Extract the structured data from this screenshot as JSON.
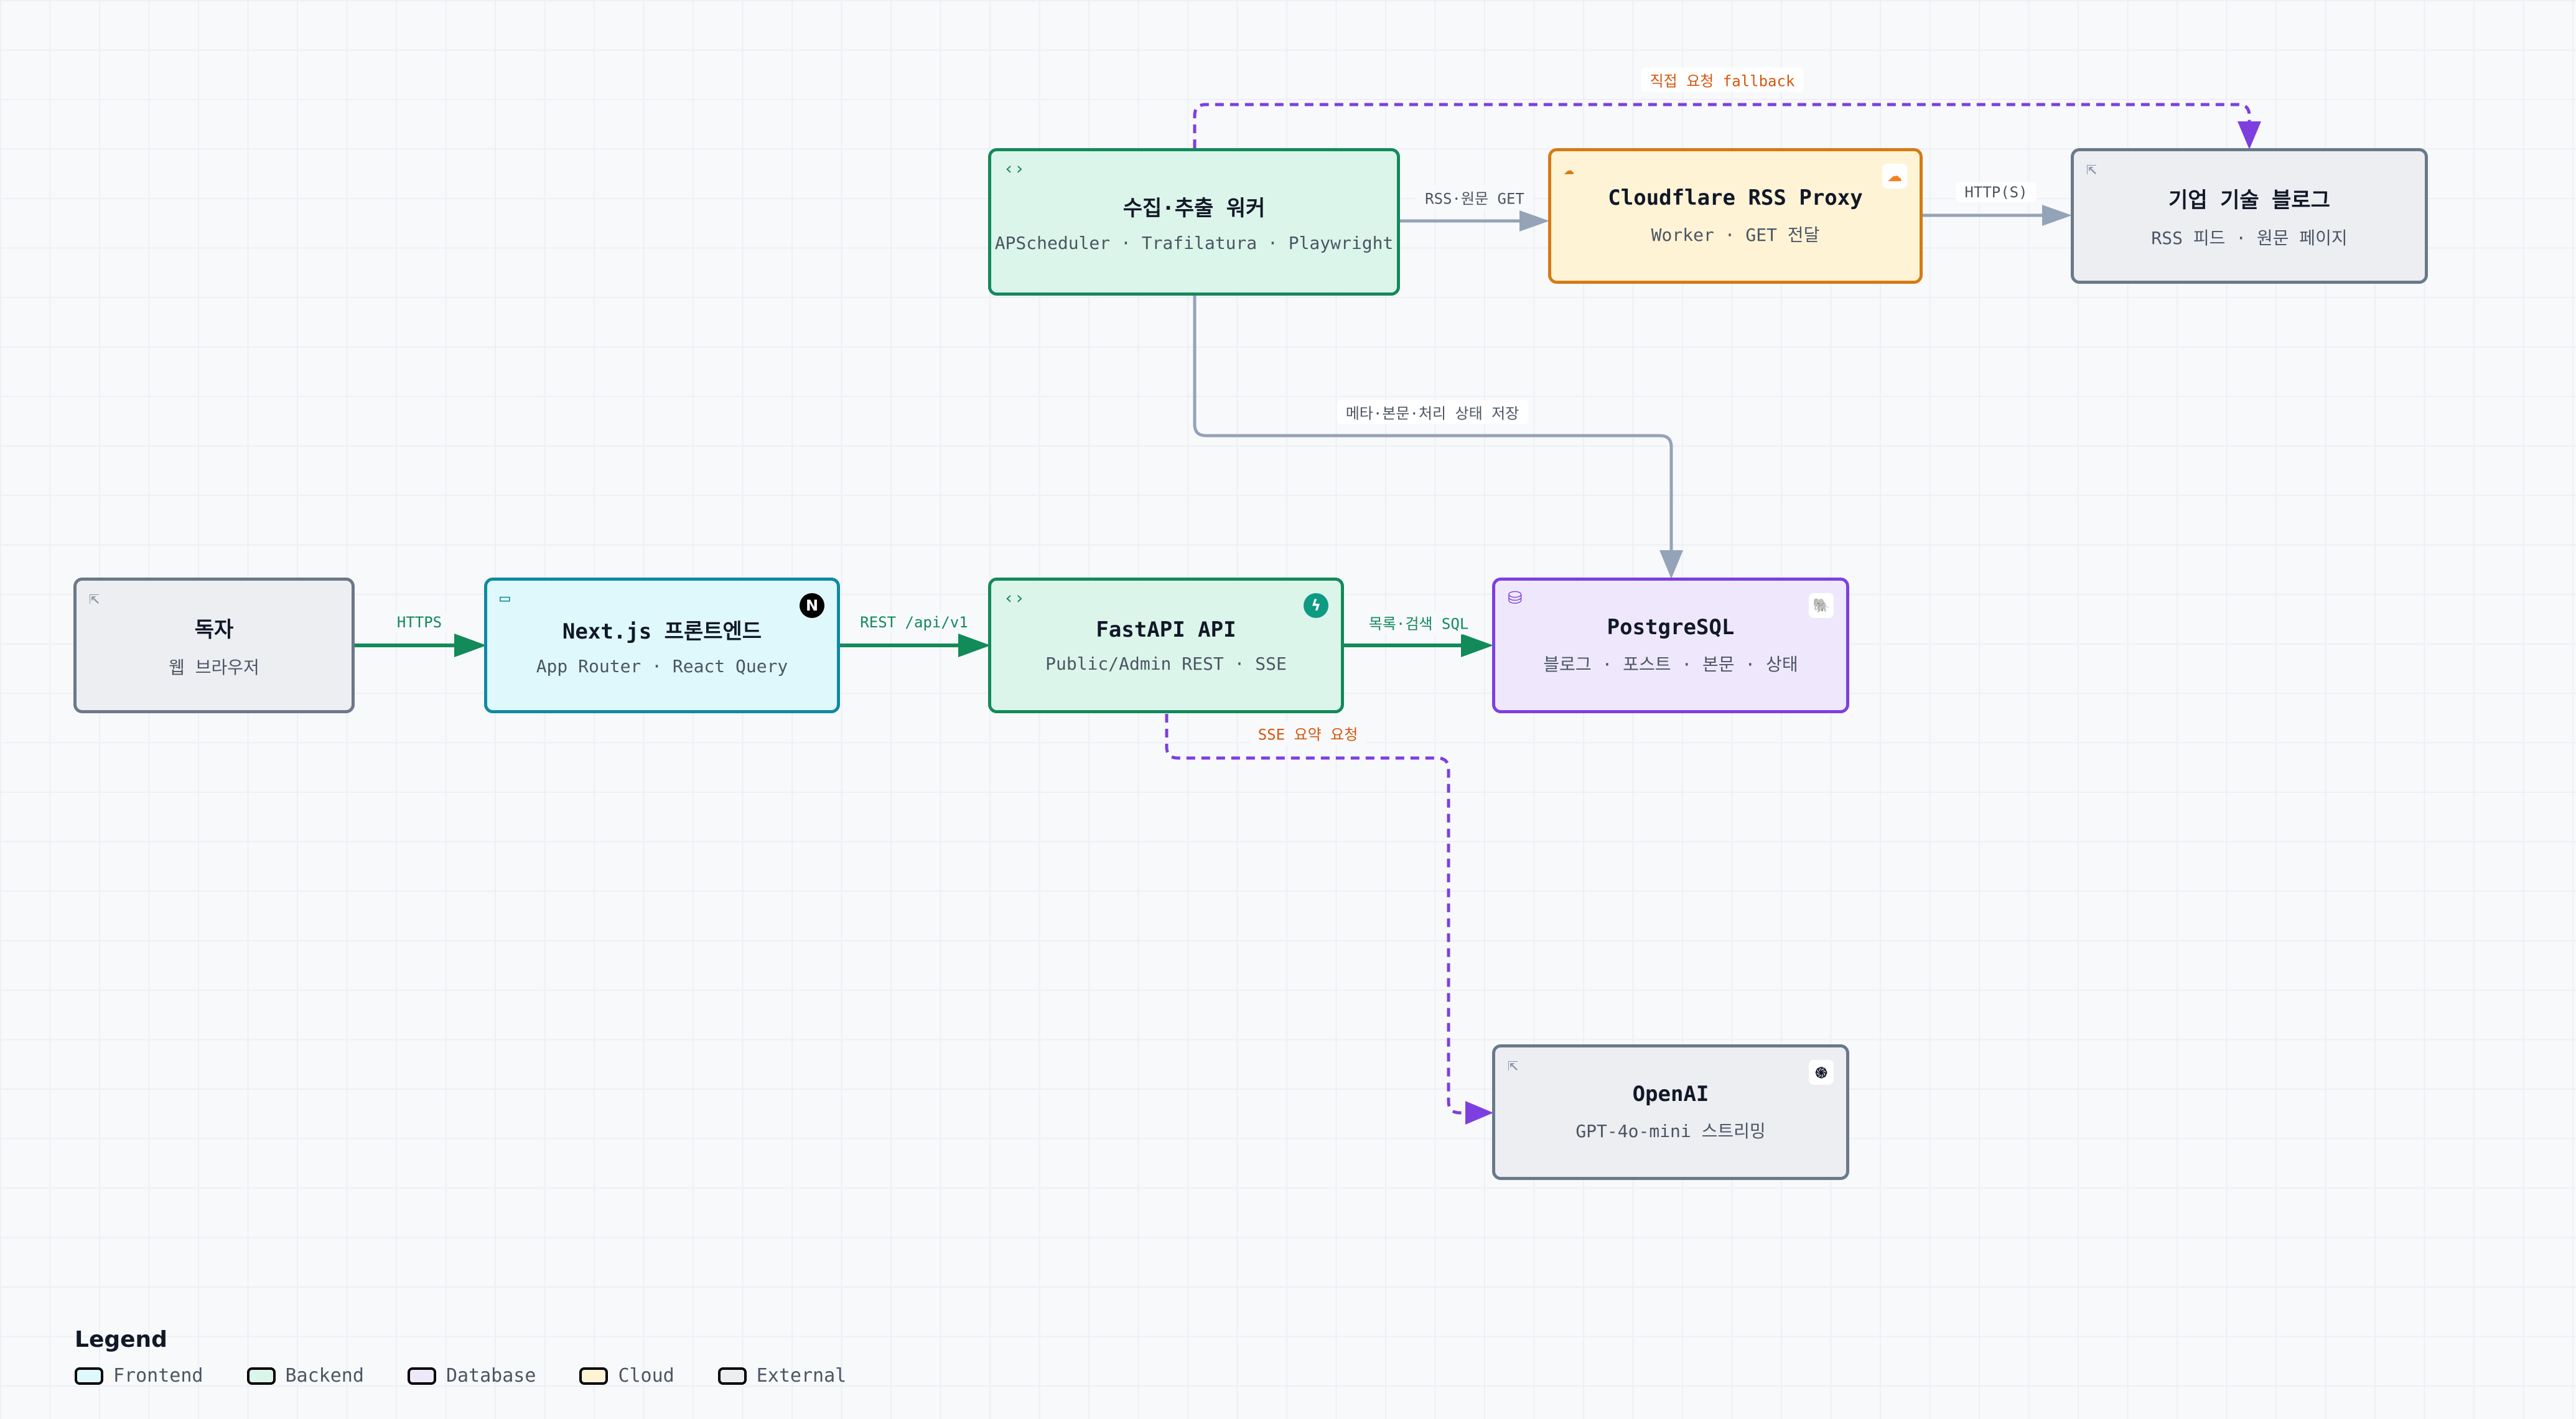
{
  "nodes": {
    "reader": {
      "title": "독자",
      "subtitle": "웹 브라우저",
      "kind": "external",
      "icon": "external-link-icon"
    },
    "nextjs": {
      "title": "Next.js 프론트엔드",
      "subtitle": "App Router · React Query",
      "kind": "frontend",
      "icon": "browser-window-icon",
      "brand_icon": "nextjs-logo-icon",
      "brand_glyph": "N"
    },
    "fastapi": {
      "title": "FastAPI API",
      "subtitle": "Public/Admin REST · SSE",
      "kind": "backend",
      "icon": "code-brackets-icon",
      "brand_icon": "fastapi-logo-icon",
      "brand_glyph": "ϟ"
    },
    "postgres": {
      "title": "PostgreSQL",
      "subtitle": "블로그 · 포스트 · 본문 · 상태",
      "kind": "database",
      "icon": "database-icon",
      "brand_icon": "postgresql-elephant-icon",
      "brand_glyph": "🐘"
    },
    "worker": {
      "title": "수집·추출 워커",
      "subtitle": "APScheduler · Trafilatura · Playwright",
      "kind": "backend",
      "icon": "code-brackets-icon"
    },
    "proxy": {
      "title": "Cloudflare RSS Proxy",
      "subtitle": "Worker · GET 전달",
      "kind": "cloud",
      "icon": "cloud-icon",
      "brand_icon": "cloudflare-logo-icon",
      "brand_glyph": "☁"
    },
    "blogs": {
      "title": "기업 기술 블로그",
      "subtitle": "RSS 피드 · 원문 페이지",
      "kind": "external",
      "icon": "external-link-icon"
    },
    "openai": {
      "title": "OpenAI",
      "subtitle": "GPT-4o-mini 스트리밍",
      "kind": "external",
      "icon": "external-link-icon",
      "brand_icon": "openai-logo-icon",
      "brand_glyph": "֍"
    }
  },
  "edges": {
    "https": {
      "label": "HTTPS",
      "from": "reader",
      "to": "nextjs",
      "style": "solid",
      "color": "#128a5a"
    },
    "rest": {
      "label": "REST /api/v1",
      "from": "nextjs",
      "to": "fastapi",
      "style": "solid",
      "color": "#128a5a"
    },
    "sql": {
      "label": "목록·검색 SQL",
      "from": "fastapi",
      "to": "postgres",
      "style": "solid",
      "color": "#128a5a"
    },
    "sse": {
      "label": "SSE 요약 요청",
      "from": "fastapi",
      "to": "openai",
      "style": "dashed",
      "color": "#7e3fe0"
    },
    "store": {
      "label": "메타·본문·처리 상태 저장",
      "from": "worker",
      "to": "postgres",
      "style": "solid",
      "color": "#94a3b8"
    },
    "rss_get": {
      "label": "RSS·원문 GET",
      "from": "worker",
      "to": "proxy",
      "style": "solid",
      "color": "#94a3b8"
    },
    "http": {
      "label": "HTTP(S)",
      "from": "proxy",
      "to": "blogs",
      "style": "solid",
      "color": "#94a3b8"
    },
    "fallback": {
      "label": "직접 요청 fallback",
      "from": "worker",
      "to": "blogs",
      "style": "dashed",
      "color": "#7e3fe0"
    }
  },
  "legend": {
    "title": "Legend",
    "items": [
      {
        "label": "Frontend",
        "kind": "frontend"
      },
      {
        "label": "Backend",
        "kind": "backend"
      },
      {
        "label": "Database",
        "kind": "database"
      },
      {
        "label": "Cloud",
        "kind": "cloud"
      },
      {
        "label": "External",
        "kind": "external"
      }
    ]
  },
  "colors": {
    "frontend_fill": "#dff8fc",
    "frontend_border": "#0e8aa0",
    "backend_fill": "#dcf5ea",
    "backend_border": "#128a5a",
    "database_fill": "#efe8fd",
    "database_border": "#7e3fe0",
    "cloud_fill": "#fff3d6",
    "cloud_border": "#d57a13",
    "external_fill": "#eceef2",
    "external_border": "#6b7889",
    "edge_green": "#128a5a",
    "edge_gray": "#94a3b8",
    "edge_purple": "#7e3fe0",
    "label_orange": "#d5570f"
  }
}
